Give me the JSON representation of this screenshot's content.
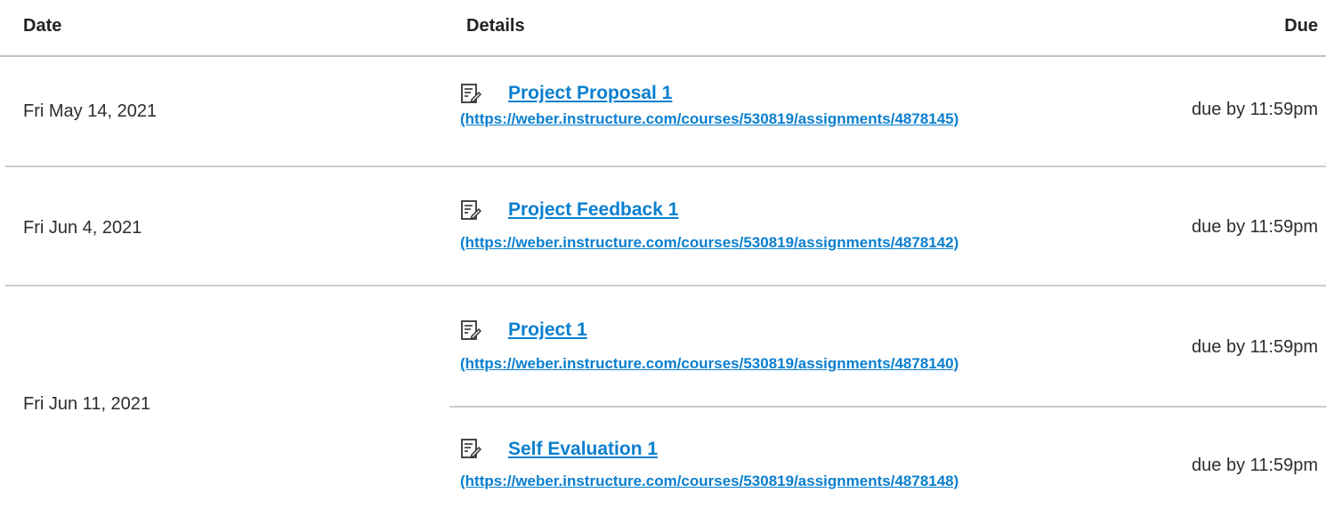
{
  "header": {
    "date_label": "Date",
    "details_label": "Details",
    "due_label": "Due"
  },
  "rows": [
    {
      "date": "Fri May 14, 2021",
      "items": [
        {
          "icon": "assignment-icon",
          "title": "Project Proposal 1",
          "url": "(https://weber.instructure.com/courses/530819/assignments/4878145)",
          "due": "due by 11:59pm"
        }
      ]
    },
    {
      "date": "Fri Jun 4, 2021",
      "items": [
        {
          "icon": "assignment-icon",
          "title": "Project Feedback 1",
          "url": "(https://weber.instructure.com/courses/530819/assignments/4878142)",
          "due": "due by 11:59pm"
        }
      ]
    },
    {
      "date": "Fri Jun 11, 2021",
      "items": [
        {
          "icon": "assignment-icon",
          "title": "Project 1",
          "url": "(https://weber.instructure.com/courses/530819/assignments/4878140)",
          "due": "due by 11:59pm"
        },
        {
          "icon": "assignment-icon",
          "title": "Self Evaluation 1",
          "url": "(https://weber.instructure.com/courses/530819/assignments/4878148)",
          "due": "due by 11:59pm"
        }
      ]
    }
  ]
}
